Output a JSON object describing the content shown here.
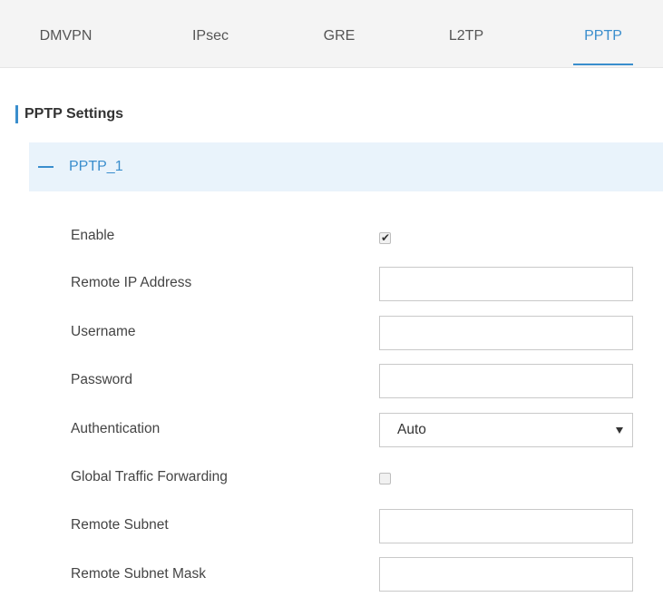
{
  "tabs": [
    {
      "label": "DMVPN"
    },
    {
      "label": "IPsec"
    },
    {
      "label": "GRE"
    },
    {
      "label": "L2TP"
    },
    {
      "label": "PPTP",
      "active": true
    }
  ],
  "section": {
    "title": "PPTP Settings"
  },
  "panel": {
    "title": "PPTP_1",
    "expanded": true
  },
  "fields": {
    "enable": {
      "label": "Enable",
      "checked": true
    },
    "remote_ip": {
      "label": "Remote IP Address",
      "value": ""
    },
    "username": {
      "label": "Username",
      "value": ""
    },
    "password": {
      "label": "Password",
      "value": ""
    },
    "authentication": {
      "label": "Authentication",
      "value": "Auto"
    },
    "global_traffic_forwarding": {
      "label": "Global Traffic Forwarding",
      "checked": false
    },
    "remote_subnet": {
      "label": "Remote Subnet",
      "value": ""
    },
    "remote_subnet_mask": {
      "label": "Remote Subnet Mask",
      "value": ""
    }
  },
  "colors": {
    "accent": "#3a8ecd",
    "tab_bar_bg": "#f4f4f4",
    "panel_header_bg": "#e9f3fb"
  }
}
